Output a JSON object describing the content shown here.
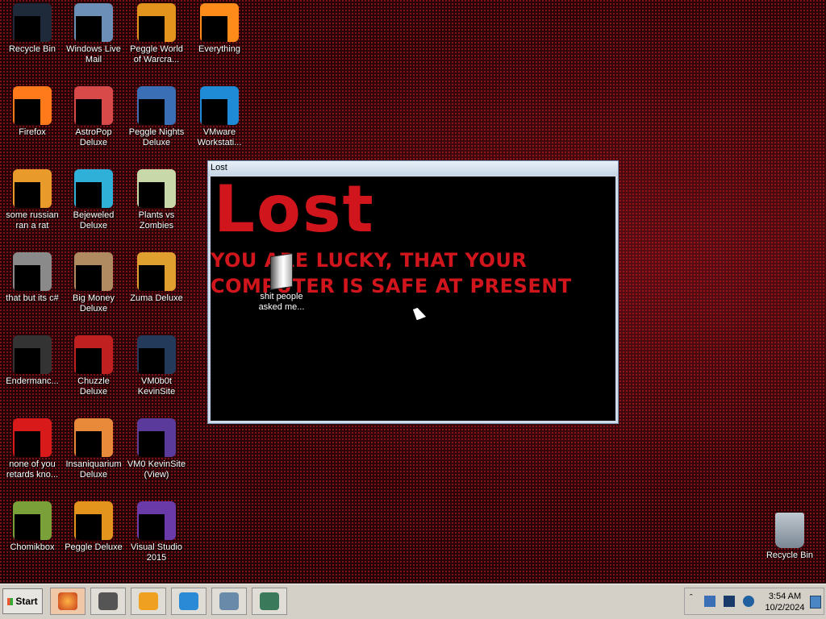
{
  "desktop_icons": [
    {
      "label": "Recycle Bin",
      "icon": "recycle-bin-icon",
      "color": "#1e2a3a"
    },
    {
      "label": "Windows Live Mail",
      "icon": "mail-icon",
      "color": "#6b8fb6"
    },
    {
      "label": "Peggle World of Warcra...",
      "icon": "peggle-icon",
      "color": "#e2941c"
    },
    {
      "label": "Everything",
      "icon": "search-icon",
      "color": "#ff8c1a"
    },
    {
      "label": "Firefox",
      "icon": "firefox-icon",
      "color": "#ff7a1a"
    },
    {
      "label": "AstroPop Deluxe",
      "icon": "astropop-icon",
      "color": "#d84a4a"
    },
    {
      "label": "Peggle Nights Deluxe",
      "icon": "peggle-nights-icon",
      "color": "#3a6fb6"
    },
    {
      "label": "VMware Workstati...",
      "icon": "vmware-icon",
      "color": "#1f8ad6"
    },
    {
      "label": "some russian ran a rat",
      "icon": "shortcut-icon",
      "color": "#e89a2a"
    },
    {
      "label": "Bejeweled Deluxe",
      "icon": "bejeweled-icon",
      "color": "#2fb0d8"
    },
    {
      "label": "Plants vs Zombies",
      "icon": "pvz-icon",
      "color": "#c8d8a8"
    },
    {
      "label": "that but its c#",
      "icon": "folder-icon",
      "color": "#8a8a8a"
    },
    {
      "label": "Big Money Deluxe",
      "icon": "moneybag-icon",
      "color": "#b08a60"
    },
    {
      "label": "Zuma Deluxe",
      "icon": "zuma-icon",
      "color": "#e0a030"
    },
    {
      "label": "Endermanc...",
      "icon": "app-icon",
      "color": "#333333"
    },
    {
      "label": "Chuzzle Deluxe",
      "icon": "chuzzle-icon",
      "color": "#c02020"
    },
    {
      "label": "VM0b0t KevinSite",
      "icon": "vscode-icon",
      "color": "#233a5a"
    },
    {
      "label": "none of you retards kno...",
      "icon": "opera-icon",
      "color": "#d81a1a"
    },
    {
      "label": "Insaniquarium Deluxe",
      "icon": "fish-icon",
      "color": "#e88a3a"
    },
    {
      "label": "VM0 KevinSite (View)",
      "icon": "vs-icon",
      "color": "#5a3a9a"
    },
    {
      "label": "Chomikbox",
      "icon": "chomikbox-icon",
      "color": "#7aa03a"
    },
    {
      "label": "Peggle Deluxe",
      "icon": "peggle-deluxe-icon",
      "color": "#e2941c"
    },
    {
      "label": "Visual Studio 2015",
      "icon": "visual-studio-icon",
      "color": "#6a3aa8"
    }
  ],
  "recycle_bin_right": {
    "label": "Recycle Bin",
    "icon": "recycle-bin-icon"
  },
  "window": {
    "title": "Lost",
    "heading": "Lost",
    "line1": "YOU ARE LUCKY, THAT YOUR",
    "line2": "COMPUTER IS SAFE AT PRESENT",
    "file_label": "shit people asked me..."
  },
  "taskbar": {
    "start_label": "Start",
    "buttons": [
      {
        "icon": "firefox-icon",
        "active": true
      },
      {
        "icon": "terminal-icon",
        "active": false
      },
      {
        "icon": "media-player-icon",
        "active": false
      },
      {
        "icon": "internet-explorer-icon",
        "active": false
      },
      {
        "icon": "network-icon",
        "active": false
      },
      {
        "icon": "window-app-icon",
        "active": false
      }
    ],
    "clock_time": "3:54 AM",
    "clock_date": "10/2/2024"
  }
}
